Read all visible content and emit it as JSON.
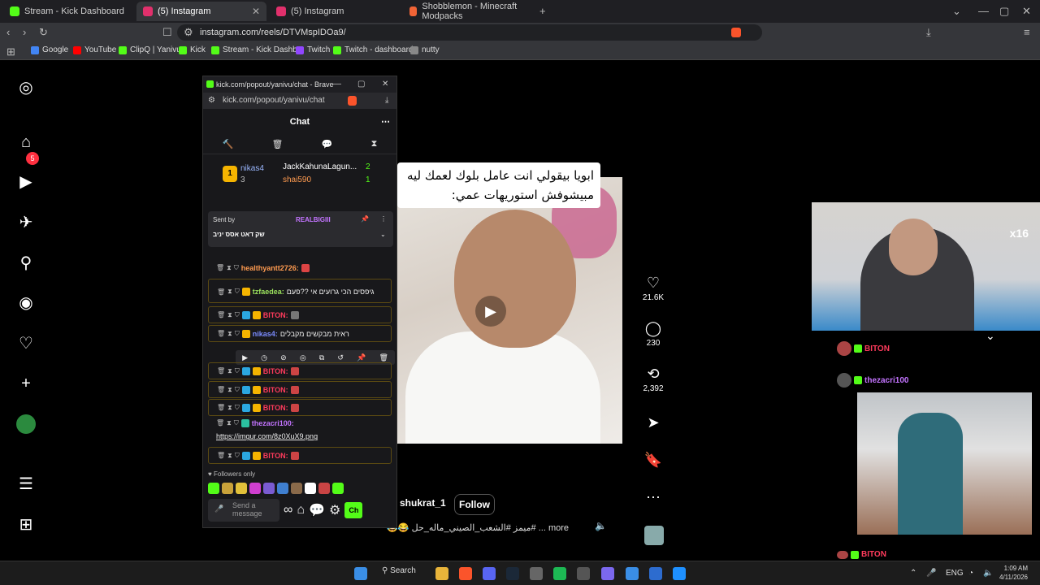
{
  "browser": {
    "tabs": [
      {
        "title": "Stream - Kick Dashboard",
        "color": "#53fc18",
        "active": false
      },
      {
        "title": "(5) Instagram",
        "color": "#e1306c",
        "active": true
      },
      {
        "title": "(5) Instagram",
        "color": "#e1306c",
        "active": false
      },
      {
        "title": "Shobblemon - Minecraft Modpacks",
        "color": "#f16436",
        "active": false
      }
    ],
    "url": "instagram.com/reels/DTVMspIDOa9/",
    "bookmarks": [
      {
        "label": "Google",
        "color": "#4285f4"
      },
      {
        "label": "YouTube",
        "color": "#ff0000"
      },
      {
        "label": "ClipQ | Yanivu",
        "color": "#53fc18"
      },
      {
        "label": "Kick",
        "color": "#53fc18"
      },
      {
        "label": "Stream - Kick Dashb...",
        "color": "#53fc18"
      },
      {
        "label": "Twitch",
        "color": "#9146ff"
      },
      {
        "label": "Twitch - dashboard",
        "color": "#53fc18"
      },
      {
        "label": "nutty",
        "color": "#888888"
      }
    ]
  },
  "instagram": {
    "notification_count": "5",
    "reel": {
      "caption": "ابويا بيقولي انت عامل بلوك لعمك ليه مبيشوفش استوريهات عمي:",
      "author": "shukrat_1",
      "follow_label": "Follow",
      "description": "#ميمز #الشعب_الصيني_ماله_حل 😂😂",
      "more": "more ...",
      "likes": "21.6K",
      "comments": "230",
      "reposts": "2,392"
    }
  },
  "chat": {
    "window_title": "kick.com/popout/yanivu/chat - Brave",
    "url": "kick.com/popout/yanivu/chat",
    "header": "Chat",
    "leaders": [
      {
        "rank": "1",
        "name": "nikas4",
        "count": "3"
      },
      {
        "name": "JackKahunaLagun...",
        "count": "2"
      },
      {
        "name": "shai590",
        "count": "1"
      }
    ],
    "pinned": {
      "prefix": "Sent by",
      "user": "REALBIGIII",
      "text": "שק דאט אסס יניב"
    },
    "messages": [
      {
        "user": "healthyantt2726:",
        "text": "",
        "cls": "u-org"
      },
      {
        "user": "tzfaedea:",
        "text": "גיפסים הכי גרועים אי ??פעם",
        "cls": "u-grn"
      },
      {
        "user": "BITON:",
        "text": "",
        "cls": "u-red"
      },
      {
        "user": "nikas4:",
        "text": "ראית מבקשים מקבלים",
        "cls": "u-blu"
      },
      {
        "user": "BITON:",
        "text": "",
        "cls": "u-red"
      },
      {
        "user": "BITON:",
        "text": "",
        "cls": "u-red"
      },
      {
        "user": "BITON:",
        "text": "",
        "cls": "u-red"
      },
      {
        "user": "thezacri100:",
        "text": "https://imgur.com/8z0XuX9.png",
        "cls": "u-pur"
      },
      {
        "user": "BITON:",
        "text": "",
        "cls": "u-red"
      }
    ],
    "followers_only": "Followers only",
    "send_placeholder": "Send a message",
    "chat_button": "Ch"
  },
  "overlay": {
    "multiplier": "x16",
    "user1": "BITON",
    "user2": "thezacri100",
    "user3": "BITON"
  },
  "taskbar": {
    "search_label": "Search",
    "lang": "ENG",
    "time": "1:09 AM",
    "date": "4/11/2026"
  }
}
